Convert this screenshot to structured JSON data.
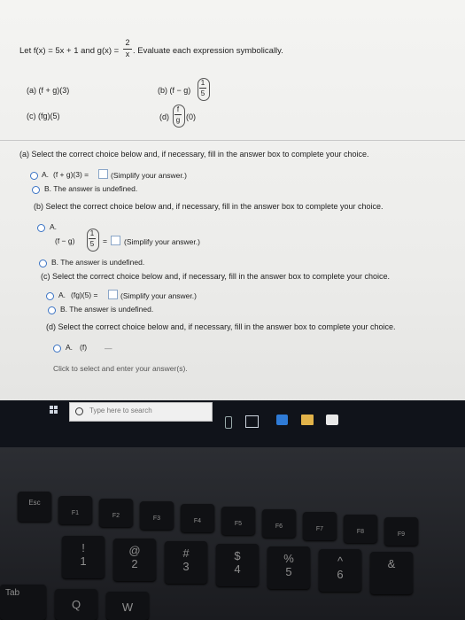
{
  "problem": {
    "prefix": "Let f(x) = 5x + 1 and g(x) =",
    "g_numerator": "2",
    "g_denominator": "x",
    "suffix": ". Evaluate each expression symbolically.",
    "parts": {
      "a": "(a) (f + g)(3)",
      "b": "(b) (f − g)",
      "c": "(c) (fg)(5)",
      "d": "(d)",
      "d_tail": "(0)"
    },
    "fractions": {
      "b_num": "1",
      "b_den": "5",
      "d_num": "f",
      "d_den": "g"
    }
  },
  "part_a": {
    "instruction": "(a) Select the correct choice below and, if necessary, fill in the answer box to complete your choice.",
    "option_a_label": "A.",
    "option_a_expr": "(f + g)(3) =",
    "option_a_hint": "(Simplify your answer.)",
    "option_b": "B.  The answer is undefined."
  },
  "part_b": {
    "instruction": "(b) Select the correct choice below and, if necessary, fill in the answer box to complete your choice.",
    "option_a_label": "A.",
    "option_a_expr": "(f − g)",
    "option_a_eq": "=",
    "option_a_hint": "(Simplify your answer.)",
    "option_b": "B.  The answer is undefined."
  },
  "part_c": {
    "instruction": "(c) Select the correct choice below and, if necessary, fill in the answer box to complete your choice.",
    "option_a_label": "A.",
    "option_a_expr": "(fg)(5) =",
    "option_a_hint": "(Simplify your answer.)",
    "option_b": "B.  The answer is undefined."
  },
  "part_d": {
    "instruction": "(d) Select the correct choice below and, if necessary, fill in the answer box to complete your choice.",
    "option_a_label": "A.",
    "option_a_expr": "(f)",
    "dash": "—"
  },
  "footer": "Click to select and enter your answer(s).",
  "taskbar": {
    "search_placeholder": "Type here to search"
  },
  "keyboard": {
    "fn_row": [
      "Esc",
      "F1",
      "F2",
      "F3",
      "F4",
      "F5",
      "F6",
      "F7",
      "F8",
      "F9"
    ],
    "num_row_top": [
      "!",
      "@",
      "#",
      "$",
      "%",
      "^",
      "&"
    ],
    "num_row": [
      "1",
      "2",
      "3",
      "4",
      "5",
      "6"
    ],
    "tab": "Tab",
    "q": "Q",
    "w": "W"
  }
}
